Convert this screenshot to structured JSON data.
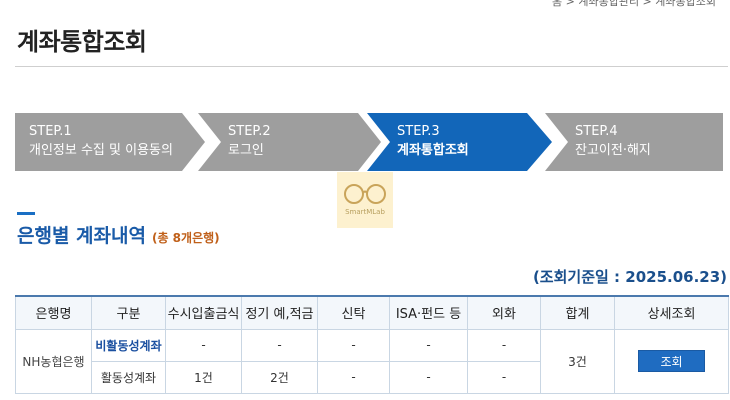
{
  "top_breadcrumb": "홈 > 계좌통합관리 > 계좌통합조회",
  "page_title": "계좌통합조회",
  "steps": [
    {
      "num": "STEP.1",
      "name": "개인정보 수집 및 이용동의",
      "state": "done"
    },
    {
      "num": "STEP.2",
      "name": "로그인",
      "state": "done"
    },
    {
      "num": "STEP.3",
      "name": "계좌통합조회",
      "state": "active"
    },
    {
      "num": "STEP.4",
      "name": "잔고이전·해지",
      "state": "pending"
    }
  ],
  "watermark": {
    "text": "SmartMLab",
    "icon": "glasses-icon"
  },
  "section": {
    "title": "은행별 계좌내역",
    "count": "(총 8개은행)"
  },
  "basis_date": "(조회기준일 : 2025.06.23)",
  "table": {
    "headers": [
      "은행명",
      "구분",
      "수시입출금식",
      "정기 예,적금",
      "신탁",
      "ISA·펀드 등",
      "외화",
      "합계",
      "상세조회"
    ],
    "rows": [
      {
        "bank": "NH농협은행",
        "total": "3건",
        "action": "조회",
        "sub": [
          {
            "type": "비활동성계좌",
            "demand": "-",
            "deposit": "-",
            "trust": "-",
            "isa": "-",
            "fx": "-"
          },
          {
            "type": "활동성계좌",
            "demand": "1건",
            "deposit": "2건",
            "trust": "-",
            "isa": "-",
            "fx": "-"
          }
        ]
      }
    ]
  },
  "colors": {
    "step_done": "#9e9e9e",
    "step_active": "#1266b9",
    "step_pending": "#9e9e9e",
    "accent": "#1a5ba8",
    "count": "#c0601a",
    "button": "#1f6cc1"
  }
}
